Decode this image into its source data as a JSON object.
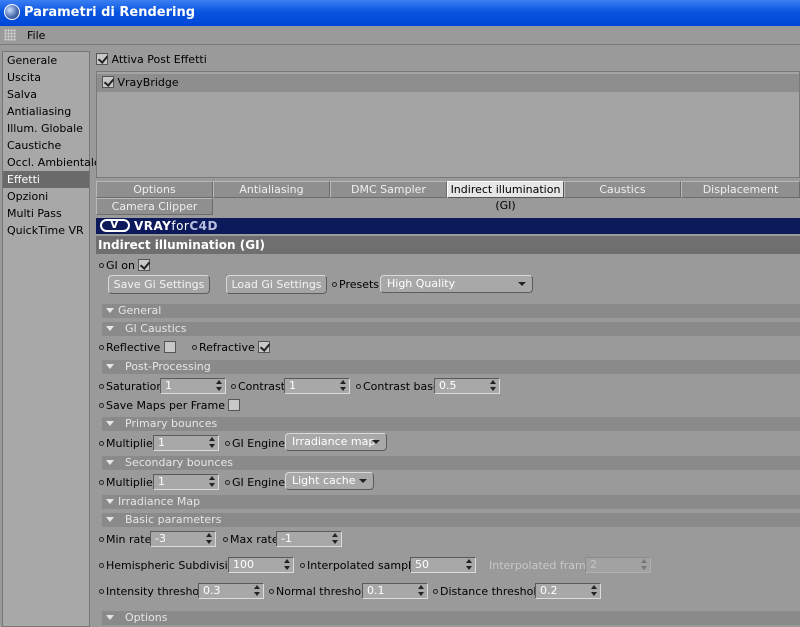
{
  "window": {
    "title": "Parametri di Rendering"
  },
  "menu": {
    "file": "File"
  },
  "sidebar": {
    "items": [
      {
        "label": "Generale"
      },
      {
        "label": "Uscita"
      },
      {
        "label": "Salva"
      },
      {
        "label": "Antialiasing"
      },
      {
        "label": "Illum. Globale"
      },
      {
        "label": "Caustiche"
      },
      {
        "label": "Occl. Ambientale"
      },
      {
        "label": "Effetti"
      },
      {
        "label": "Opzioni"
      },
      {
        "label": "Multi Pass"
      },
      {
        "label": "QuickTime VR"
      }
    ],
    "selected": "Effetti"
  },
  "post": {
    "enable_label": "Attiva Post Effetti",
    "list_item": "VrayBridge"
  },
  "tabs": [
    "Options",
    "Antialiasing",
    "DMC Sampler",
    "Indirect illumination (GI)",
    "Caustics",
    "Displacement",
    "Camera Clipper"
  ],
  "banner": {
    "vray": "VRAY",
    "for": "for",
    "c4d": "C4D"
  },
  "panel": {
    "title": "Indirect illumination (GI)",
    "gi_on": "GI on",
    "save_btn": "Save Gi Settings",
    "load_btn": "Load Gi Settings",
    "presets_label": "Presets",
    "presets_value": "High Quality",
    "sections": {
      "general": "General",
      "gi_caustics": "GI Caustics",
      "post_processing": "Post-Processing",
      "primary": "Primary bounces",
      "secondary": "Secondary bounces",
      "irradiance": "Irradiance Map",
      "basic": "Basic parameters",
      "options": "Options"
    },
    "reflective": "Reflective",
    "refractive": "Refractive",
    "saturation_label": "Saturation",
    "saturation": "1",
    "contrast_label": "Contrast",
    "contrast": "1",
    "contrast_base_label": "Contrast base",
    "contrast_base": "0.5",
    "save_maps": "Save Maps per Frame",
    "multiplier_label": "Multiplier",
    "primary_multiplier": "1",
    "gi_engine_label": "GI Engine",
    "primary_engine": "Irradiance map",
    "secondary_multiplier": "1",
    "secondary_engine": "Light cache",
    "min_rate_label": "Min rate",
    "min_rate": "-3",
    "max_rate_label": "Max rate",
    "max_rate": "-1",
    "hemi_label": "Hemispheric Subdivision",
    "hemi": "100",
    "interp_samples_label": "Interpolated samples",
    "interp_samples": "50",
    "interp_frames_label": "Interpolated frames",
    "interp_frames": "2",
    "intensity_label": "Intensity threshold",
    "intensity": "0.3",
    "normal_label": "Normal threshold",
    "normal": "0.1",
    "distance_label": "Distance threshold",
    "distance": "0.2"
  }
}
